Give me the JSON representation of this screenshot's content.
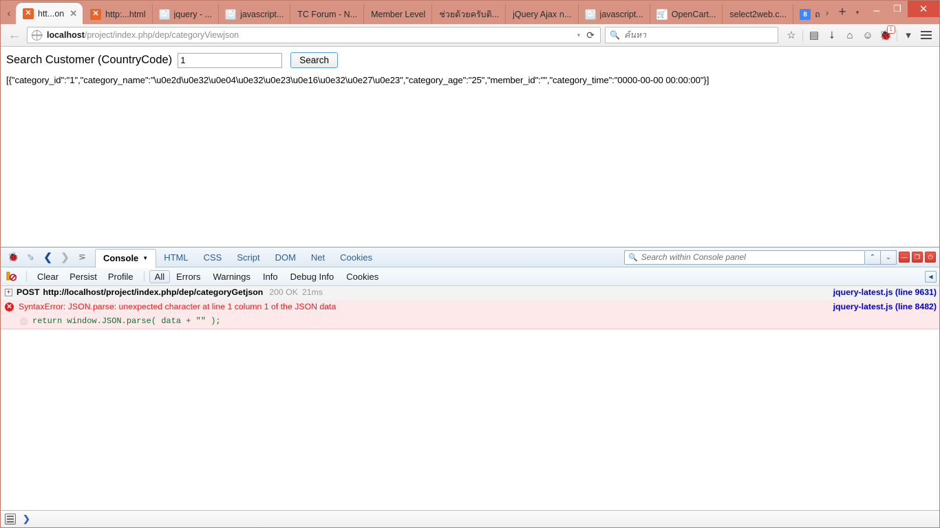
{
  "browser": {
    "tabs": [
      {
        "title": "htt...on",
        "favicon": "xampp-icon",
        "active": true,
        "closable": true
      },
      {
        "title": "http:...html",
        "favicon": "xampp-icon",
        "active": false,
        "closable": false
      },
      {
        "title": "jquery - ...",
        "favicon": "script-icon",
        "active": false,
        "closable": false
      },
      {
        "title": "javascript...",
        "favicon": "script-icon",
        "active": false,
        "closable": false
      },
      {
        "title": "TC Forum - N...",
        "favicon": "none",
        "active": false,
        "closable": false
      },
      {
        "title": "Member Level",
        "favicon": "none",
        "active": false,
        "closable": false
      },
      {
        "title": "ช่วยด้วยครับติ...",
        "favicon": "none",
        "active": false,
        "closable": false
      },
      {
        "title": "jQuery Ajax ก...",
        "favicon": "none",
        "active": false,
        "closable": false
      },
      {
        "title": "javascript...",
        "favicon": "script-icon",
        "active": false,
        "closable": false
      },
      {
        "title": "OpenCart...",
        "favicon": "opencart-icon",
        "active": false,
        "closable": false
      },
      {
        "title": "select2web.c...",
        "favicon": "none",
        "active": false,
        "closable": false
      },
      {
        "title": "ถ",
        "favicon": "google-icon",
        "active": false,
        "closable": false
      }
    ],
    "tabstrip_controls": {
      "scroll_left": "‹",
      "scroll_right": "›",
      "new_tab": "+",
      "list_all_tabs": "▾"
    },
    "window_controls": {
      "minimize": "–",
      "restore": "❐",
      "close": "✕"
    },
    "address_bar": {
      "url_host": "localhost",
      "url_path": "/project/index.php/dep/categoryViewjson",
      "dropdown": "▾",
      "reload": "⟳"
    },
    "search_bar": {
      "placeholder": "ค้นหา"
    },
    "toolbar_icons": [
      {
        "name": "bookmark-star-icon",
        "glyph": "☆"
      },
      {
        "name": "reader-list-icon",
        "glyph": "▤"
      },
      {
        "name": "downloads-icon",
        "glyph": "⭣"
      },
      {
        "name": "home-icon",
        "glyph": "⌂"
      },
      {
        "name": "chat-icon",
        "glyph": "☺"
      },
      {
        "name": "firebug-icon",
        "glyph": "🐞",
        "badge": "1"
      },
      {
        "name": "overflow-caret-icon",
        "glyph": "▾"
      }
    ]
  },
  "page": {
    "label": "Search Customer (CountryCode)",
    "input_value": "1",
    "input_placeholder": "",
    "search_button": "Search",
    "json_output": "[{\"category_id\":\"1\",\"category_name\":\"\\u0e2d\\u0e32\\u0e04\\u0e32\\u0e23\\u0e16\\u0e32\\u0e27\\u0e23\",\"category_age\":\"25\",\"member_id\":\"\",\"category_time\":\"0000-00-00 00:00:00\"}]"
  },
  "firebug": {
    "toolbar_icons": [
      {
        "name": "firebug-bug-icon",
        "glyph": "🐞"
      },
      {
        "name": "inspect-element-icon",
        "glyph": "⬂"
      },
      {
        "name": "nav-back-icon",
        "glyph": "❮"
      },
      {
        "name": "nav-forward-icon",
        "glyph": "❯"
      },
      {
        "name": "quick-info-icon",
        "glyph": "⋝"
      }
    ],
    "panels": [
      {
        "label": "Console",
        "active": true,
        "has_dropdown": true
      },
      {
        "label": "HTML",
        "active": false,
        "has_dropdown": false
      },
      {
        "label": "CSS",
        "active": false,
        "has_dropdown": false
      },
      {
        "label": "Script",
        "active": false,
        "has_dropdown": false
      },
      {
        "label": "DOM",
        "active": false,
        "has_dropdown": false
      },
      {
        "label": "Net",
        "active": false,
        "has_dropdown": false
      },
      {
        "label": "Cookies",
        "active": false,
        "has_dropdown": false
      }
    ],
    "panel_search_placeholder": "Search within Console panel",
    "panel_search_up": "⌃",
    "panel_search_down": "⌄",
    "window_buttons": [
      {
        "name": "minimize-firebug-button",
        "glyph": "—"
      },
      {
        "name": "detach-firebug-button",
        "glyph": "❐"
      },
      {
        "name": "close-firebug-button",
        "glyph": "⏻"
      }
    ],
    "console_actions": [
      "Clear",
      "Persist",
      "Profile"
    ],
    "console_filters": [
      {
        "label": "All",
        "selected": true
      },
      {
        "label": "Errors",
        "selected": false
      },
      {
        "label": "Warnings",
        "selected": false
      },
      {
        "label": "Info",
        "selected": false
      },
      {
        "label": "Debug Info",
        "selected": false
      },
      {
        "label": "Cookies",
        "selected": false
      }
    ],
    "collapse_sidepanel": "◀",
    "log": [
      {
        "type": "request",
        "method": "POST",
        "url": "http://localhost/project/index.php/dep/categoryGetjson",
        "status": "200 OK",
        "time": "21ms",
        "source_file": "jquery-latest.js (line 9631)"
      },
      {
        "type": "error",
        "message": "SyntaxError: JSON.parse: unexpected character at line 1 column 1 of the JSON data",
        "source_file": "jquery-latest.js (line 8482)"
      },
      {
        "type": "error-source",
        "code": "return window.JSON.parse( data + \"\" );"
      }
    ]
  },
  "statusbar": {
    "panel_icon": "▤",
    "chevron": "❯"
  },
  "colors": {
    "titlebar": "#d99383",
    "close_button": "#d94f42",
    "error_text": "#e02020",
    "error_bg": "#fde9ea",
    "link_blue": "#0000cc"
  }
}
